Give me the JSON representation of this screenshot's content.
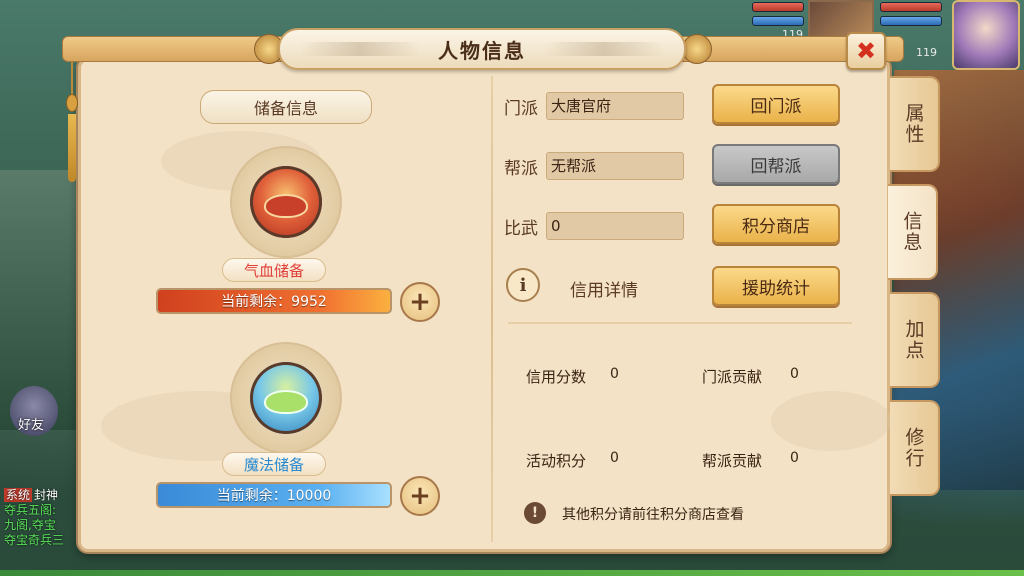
{
  "window": {
    "title": "人物信息"
  },
  "hud": {
    "pet_level": "119",
    "hero_level": "119",
    "friend_label": "好友",
    "chat": [
      {
        "tag": "系统",
        "text": "封神"
      },
      {
        "text": "夺兵五阁:"
      },
      {
        "text": "九阁,夺宝"
      },
      {
        "text": "夺宝奇兵三"
      }
    ]
  },
  "reserve": {
    "header": "储备信息",
    "hp": {
      "name": "气血储备",
      "remaining": "当前剩余：9952"
    },
    "mp": {
      "name": "魔法储备",
      "remaining": "当前剩余：10000"
    }
  },
  "fields": {
    "sect": {
      "label": "门派",
      "value": "大唐官府",
      "button": "回门派"
    },
    "guild": {
      "label": "帮派",
      "value": "无帮派",
      "button": "回帮派"
    },
    "arena": {
      "label": "比武",
      "value": "0",
      "button": "积分商店"
    },
    "credit": {
      "label": "信用详情",
      "button": "援助统计"
    }
  },
  "stats": {
    "credit_score": {
      "label": "信用分数",
      "value": "0"
    },
    "sect_contribution": {
      "label": "门派贡献",
      "value": "0"
    },
    "activity_points": {
      "label": "活动积分",
      "value": "0"
    },
    "guild_contribution": {
      "label": "帮派贡献",
      "value": "0"
    }
  },
  "footnote": "其他积分请前往积分商店查看",
  "tabs": [
    {
      "label": "属性"
    },
    {
      "label": "信息",
      "active": true
    },
    {
      "label": "加点"
    },
    {
      "label": "修行"
    }
  ],
  "colors": {
    "panel_bg": "#f4e2c6",
    "gold_button": "#eab24a",
    "disabled_button": "#a8a8a8",
    "hp_bar": "#e0503a",
    "mp_bar": "#3a8ad8",
    "close_x": "#d43020"
  },
  "icons": {
    "close": "close-icon",
    "plus": "plus-icon",
    "info": "info-icon",
    "warning": "exclamation-icon"
  }
}
